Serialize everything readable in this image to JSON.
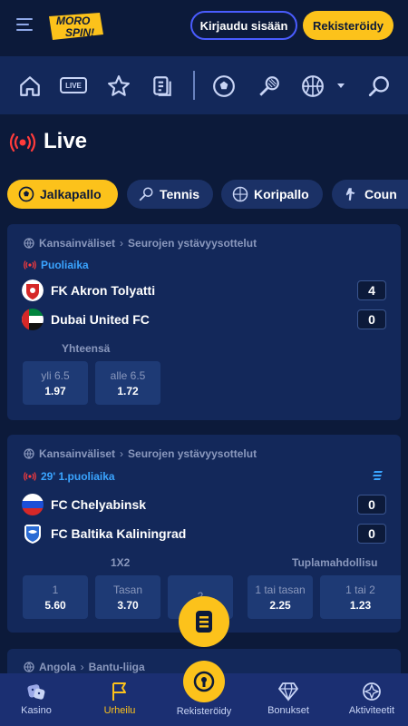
{
  "header": {
    "logo_line1": "MORO",
    "logo_line2": "SPIN!",
    "login_label": "Kirjaudu sisään",
    "register_label": "Rekisteröidy"
  },
  "nav": {
    "live_badge": "LIVE",
    "icons": [
      "home-icon",
      "live-icon",
      "star-icon",
      "betslip-icon",
      "football-icon",
      "tennis-icon",
      "basketball-icon",
      "chevron-down-icon",
      "search-icon"
    ]
  },
  "page": {
    "title": "Live"
  },
  "sport_tabs": [
    {
      "label": "Jalkapallo",
      "active": true
    },
    {
      "label": "Tennis",
      "active": false
    },
    {
      "label": "Koripallo",
      "active": false
    },
    {
      "label": "Coun",
      "active": false
    }
  ],
  "matches": [
    {
      "region": "Kansainväliset",
      "league": "Seurojen ystävyysottelut",
      "status": "Puoliaika",
      "home": {
        "name": "FK Akron Tolyatti",
        "score": "4"
      },
      "away": {
        "name": "Dubai United FC",
        "score": "0"
      },
      "market_label": "Yhteensä",
      "odds": [
        {
          "label": "yli 6.5",
          "value": "1.97"
        },
        {
          "label": "alle 6.5",
          "value": "1.72"
        }
      ]
    },
    {
      "region": "Kansainväliset",
      "league": "Seurojen ystävyysottelut",
      "status": "29' 1.puoliaika",
      "home": {
        "name": "FC Chelyabinsk",
        "score": "0"
      },
      "away": {
        "name": "FC Baltika Kaliningrad",
        "score": "0"
      },
      "market_label": "1X2",
      "market_label_2": "Tuplamahdollisu",
      "odds": [
        {
          "label": "1",
          "value": "5.60"
        },
        {
          "label": "Tasan",
          "value": "3.70"
        },
        {
          "label": "2",
          "value": ""
        },
        {
          "label": "1 tai tasan",
          "value": "2.25"
        },
        {
          "label": "1 tai 2",
          "value": "1.23"
        }
      ]
    },
    {
      "region": "Angola",
      "league": "Bantu-liiga"
    }
  ],
  "bottom_nav": [
    {
      "label": "Kasino",
      "icon": "dice-icon",
      "active": false
    },
    {
      "label": "Urheilu",
      "icon": "flag-icon",
      "active": true
    },
    {
      "label": "Rekisteröidy",
      "icon": "keyhole-icon",
      "active": false
    },
    {
      "label": "Bonukset",
      "icon": "diamond-icon",
      "active": false
    },
    {
      "label": "Aktiviteetit",
      "icon": "activity-icon",
      "active": false
    }
  ],
  "colors": {
    "background": "#0c1a3a",
    "card": "#13285a",
    "accent_yellow": "#fcc21b",
    "live_red": "#ff3b3b",
    "status_blue": "#3aa4ff"
  }
}
